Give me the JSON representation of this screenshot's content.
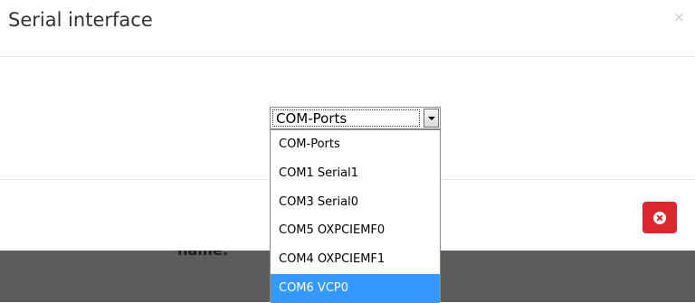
{
  "modal": {
    "title": "Serial interface",
    "close_symbol": "×"
  },
  "backdrop": {
    "partial_label": "name:"
  },
  "select": {
    "value": "COM-Ports",
    "options": [
      {
        "label": "COM-Ports",
        "selected": false
      },
      {
        "label": "COM1 Serial1",
        "selected": false
      },
      {
        "label": "COM3 Serial0",
        "selected": false
      },
      {
        "label": "COM5 OXPCIEMF0",
        "selected": false
      },
      {
        "label": "COM4 OXPCIEMF1",
        "selected": false
      },
      {
        "label": "COM6 VCP0",
        "selected": true
      }
    ]
  },
  "icons": {
    "close": "close-icon",
    "delete": "delete-circle-icon",
    "dropdown_arrow": "chevron-down-icon"
  },
  "colors": {
    "delete_button": "#d9262f",
    "selected_option": "#3399ff",
    "backdrop": "#5c5c5c"
  }
}
